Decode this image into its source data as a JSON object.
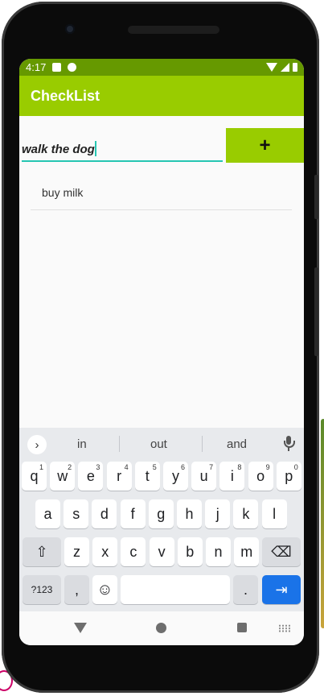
{
  "status": {
    "time": "4:17"
  },
  "app": {
    "title": "CheckList"
  },
  "input": {
    "value": "walk the dog"
  },
  "add_button": {
    "label": "+"
  },
  "list": {
    "items": [
      {
        "label": "buy milk"
      }
    ]
  },
  "keyboard": {
    "suggestions": [
      "in",
      "out",
      "and"
    ],
    "row1": [
      {
        "k": "q",
        "h": "1"
      },
      {
        "k": "w",
        "h": "2"
      },
      {
        "k": "e",
        "h": "3"
      },
      {
        "k": "r",
        "h": "4"
      },
      {
        "k": "t",
        "h": "5"
      },
      {
        "k": "y",
        "h": "6"
      },
      {
        "k": "u",
        "h": "7"
      },
      {
        "k": "i",
        "h": "8"
      },
      {
        "k": "o",
        "h": "9"
      },
      {
        "k": "p",
        "h": "0"
      }
    ],
    "row2": [
      "a",
      "s",
      "d",
      "f",
      "g",
      "h",
      "j",
      "k",
      "l"
    ],
    "row3": [
      "z",
      "x",
      "c",
      "v",
      "b",
      "n",
      "m"
    ],
    "symbols_label": "?123",
    "comma": ",",
    "period": ".",
    "shift_glyph": "⇧",
    "backspace_glyph": "⌫",
    "emoji_glyph": "☺",
    "enter_glyph": "⇥",
    "expand_glyph": "›"
  },
  "colors": {
    "status_bar": "#669900",
    "app_bar": "#99cc00",
    "accent_underline": "#26c6b2",
    "action_key": "#1a73e8"
  }
}
